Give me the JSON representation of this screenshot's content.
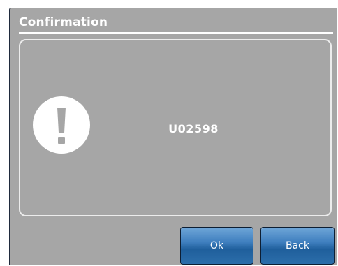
{
  "dialog": {
    "title": "Confirmation",
    "message": "U02598",
    "icon": "exclamation-icon",
    "buttons": {
      "ok_label": "Ok",
      "back_label": "Back"
    }
  },
  "colors": {
    "dialog_background": "#a6a6a6",
    "text": "#ffffff",
    "button_blue": "#2c6eaa"
  }
}
